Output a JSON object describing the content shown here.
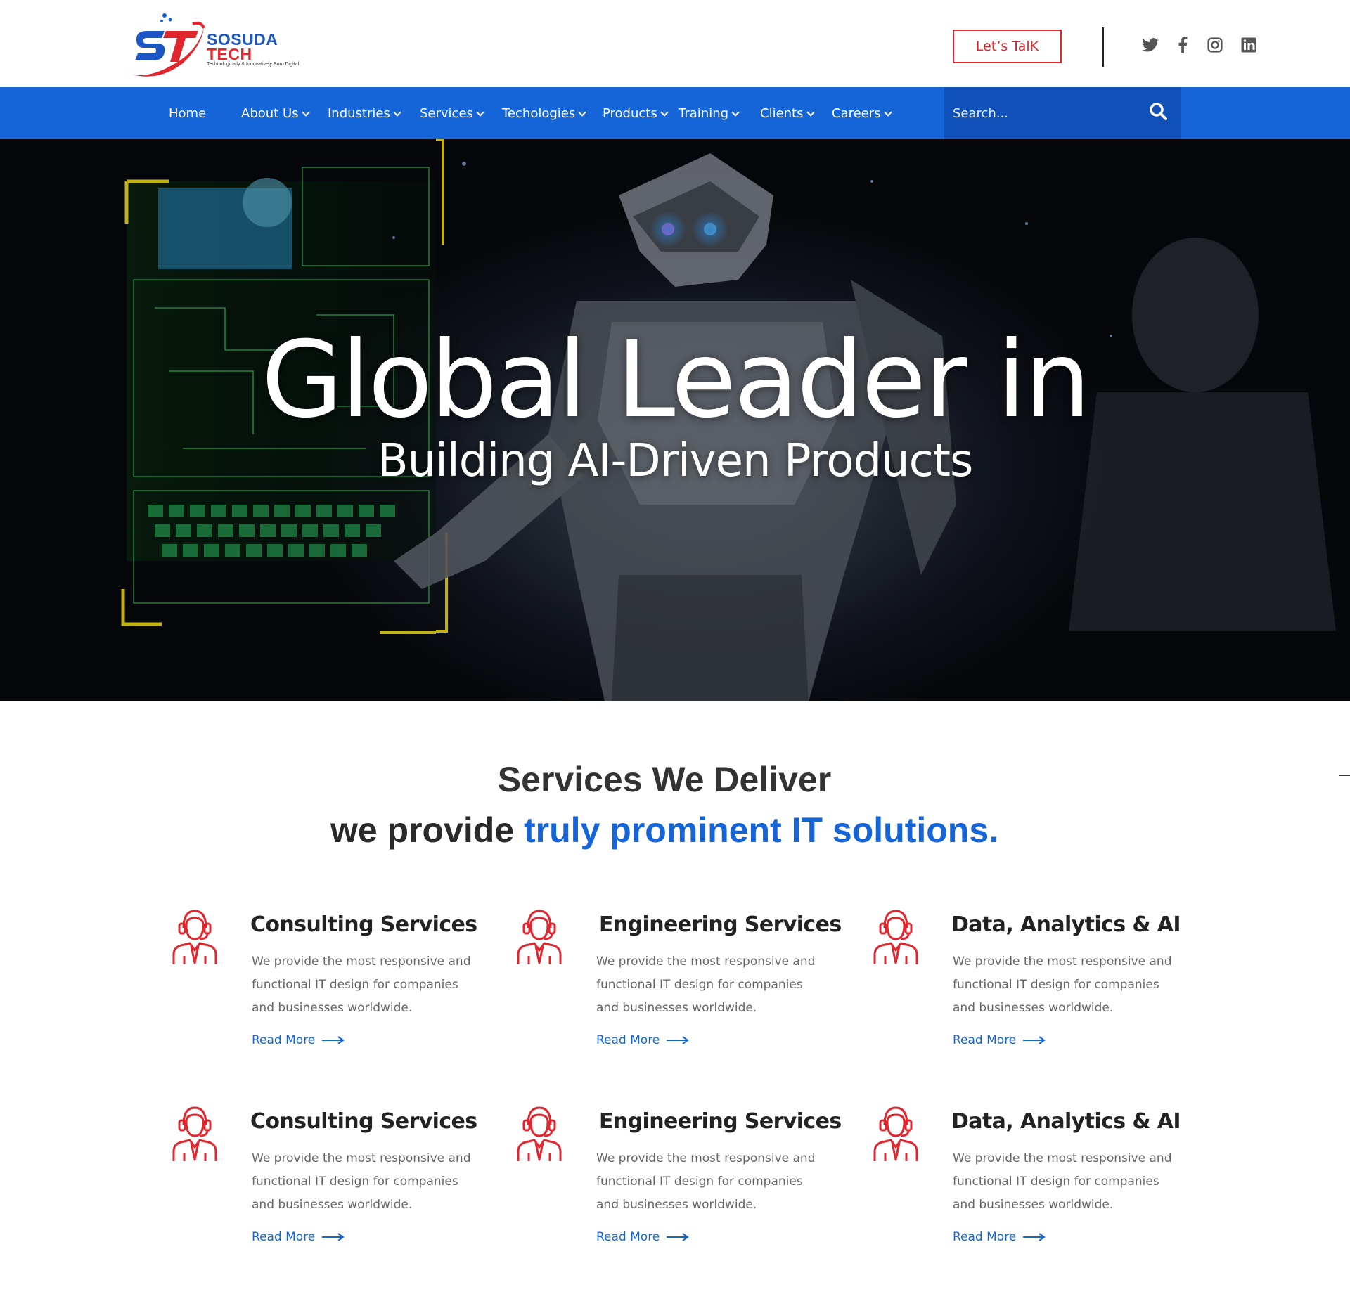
{
  "brand": {
    "name_line1": "SOSUDA",
    "name_line2": "TECH",
    "tagline": "Technologically & Innovatively Born Digital",
    "primary_color": "#1565d8",
    "accent_color": "#e1262d"
  },
  "header": {
    "cta_label": "Let’s TalK",
    "social_icons": [
      "twitter-icon",
      "facebook-icon",
      "instagram-icon",
      "linkedin-icon"
    ]
  },
  "nav": {
    "items": [
      {
        "label": "Home",
        "has_dropdown": false
      },
      {
        "label": "About Us",
        "has_dropdown": true
      },
      {
        "label": "Industries",
        "has_dropdown": true
      },
      {
        "label": "Services",
        "has_dropdown": true
      },
      {
        "label": "Techologies",
        "has_dropdown": true
      },
      {
        "label": "Products",
        "has_dropdown": true
      },
      {
        "label": "Training",
        "has_dropdown": true
      },
      {
        "label": "Clients",
        "has_dropdown": true
      },
      {
        "label": "Careers",
        "has_dropdown": true
      }
    ],
    "search_placeholder": "Search..."
  },
  "hero": {
    "title": "Global Leader in",
    "subtitle": "Building AI-Driven Products"
  },
  "services": {
    "title": "Services We Deliver",
    "subtitle_plain": "we provide ",
    "subtitle_highlight": "truly prominent IT solutions.",
    "cards": [
      {
        "title": "Consulting Services",
        "desc": "We provide the most responsive and functional IT design for companies and businesses worldwide.",
        "link": "Read More"
      },
      {
        "title": "Engineering Services",
        "desc": "We provide the most responsive and functional IT design for companies and businesses worldwide.",
        "link": "Read More"
      },
      {
        "title": "Data, Analytics & AI",
        "desc": "We provide the most responsive and functional IT design for companies and businesses worldwide.",
        "link": "Read More"
      },
      {
        "title": "Consulting Services",
        "desc": "We provide the most responsive and functional IT design for companies and businesses worldwide.",
        "link": "Read More"
      },
      {
        "title": "Engineering Services",
        "desc": "We provide the most responsive and functional IT design for companies and businesses worldwide.",
        "link": "Read More"
      },
      {
        "title": "Data, Analytics & AI",
        "desc": "We provide the most responsive and functional IT design for companies and businesses worldwide.",
        "link": "Read More"
      }
    ]
  }
}
